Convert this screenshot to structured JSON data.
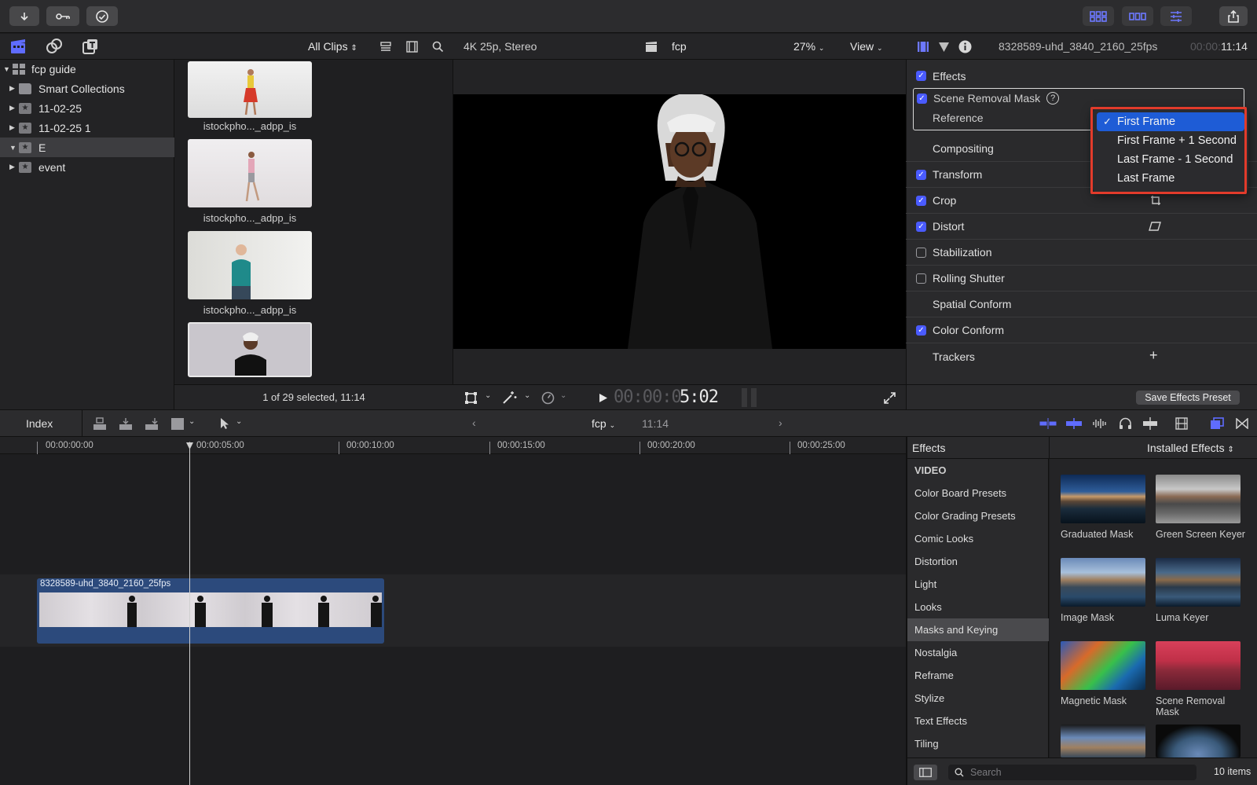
{
  "library": {
    "name": "fcp guide",
    "items": [
      {
        "label": "Smart Collections",
        "kind": "folder"
      },
      {
        "label": "11-02-25",
        "kind": "event"
      },
      {
        "label": "11-02-25 1",
        "kind": "event"
      },
      {
        "label": "E",
        "kind": "event",
        "selected": true
      },
      {
        "label": "event",
        "kind": "event"
      }
    ]
  },
  "browser": {
    "filter": "All Clips",
    "clips": [
      {
        "caption": "istockpho..._adpp_is"
      },
      {
        "caption": "istockpho..._adpp_is"
      },
      {
        "caption": "istockpho..._adpp_is"
      },
      {
        "caption": ""
      }
    ],
    "selection_status": "1 of 29 selected, 11:14"
  },
  "viewer": {
    "format": "4K 25p, Stereo",
    "project": "fcp",
    "zoom": "27%",
    "view_label": "View",
    "timecode_dim": "00:00:0",
    "timecode_bright": "5:02"
  },
  "inspector": {
    "clip_name": "8328589-uhd_3840_2160_25fps",
    "duration_dim": "00:00:",
    "duration": "11:14",
    "rows": [
      {
        "label": "Effects",
        "check": "on"
      },
      {
        "label": "Scene Removal Mask",
        "check": "on"
      },
      {
        "label": "Reference",
        "check": "none"
      },
      {
        "label": "Compositing",
        "check": "none"
      },
      {
        "label": "Transform",
        "check": "on"
      },
      {
        "label": "Crop",
        "check": "on"
      },
      {
        "label": "Distort",
        "check": "on"
      },
      {
        "label": "Stabilization",
        "check": "off"
      },
      {
        "label": "Rolling Shutter",
        "check": "off"
      },
      {
        "label": "Spatial Conform",
        "check": "none"
      },
      {
        "label": "Color Conform",
        "check": "on"
      },
      {
        "label": "Trackers",
        "check": "none"
      }
    ],
    "save_preset": "Save Effects Preset",
    "reference_options": [
      "First Frame",
      "First Frame + 1 Second",
      "Last Frame - 1 Second",
      "Last Frame"
    ],
    "reference_selected": "First Frame",
    "help_glyph": "?",
    "trackers_add": "+"
  },
  "timeline": {
    "index_label": "Index",
    "project": "fcp",
    "duration": "11:14",
    "ruler_ticks": [
      "00:00:00:00",
      "00:00:05:00",
      "00:00:10:00",
      "00:00:15:00",
      "00:00:20:00",
      "00:00:25:00"
    ],
    "clip_name": "8328589-uhd_3840_2160_25fps"
  },
  "effects": {
    "title": "Effects",
    "filter": "Installed Effects",
    "section": "VIDEO",
    "categories": [
      "Color Board Presets",
      "Color Grading Presets",
      "Comic Looks",
      "Distortion",
      "Light",
      "Looks",
      "Masks and Keying",
      "Nostalgia",
      "Reframe",
      "Stylize",
      "Text Effects",
      "Tiling"
    ],
    "selected_category": "Masks and Keying",
    "tiles": [
      {
        "name": "Graduated Mask"
      },
      {
        "name": "Green Screen Keyer"
      },
      {
        "name": "Image Mask"
      },
      {
        "name": "Luma Keyer"
      },
      {
        "name": "Magnetic Mask"
      },
      {
        "name": "Scene Removal Mask"
      },
      {
        "name": ""
      },
      {
        "name": ""
      }
    ],
    "search_placeholder": "Search",
    "count": "10 items"
  },
  "colors": {
    "accent": "#4a5bff",
    "selection": "#1e5cd6",
    "highlight_box": "#e23b2b",
    "clip": "#2c4a7c"
  }
}
